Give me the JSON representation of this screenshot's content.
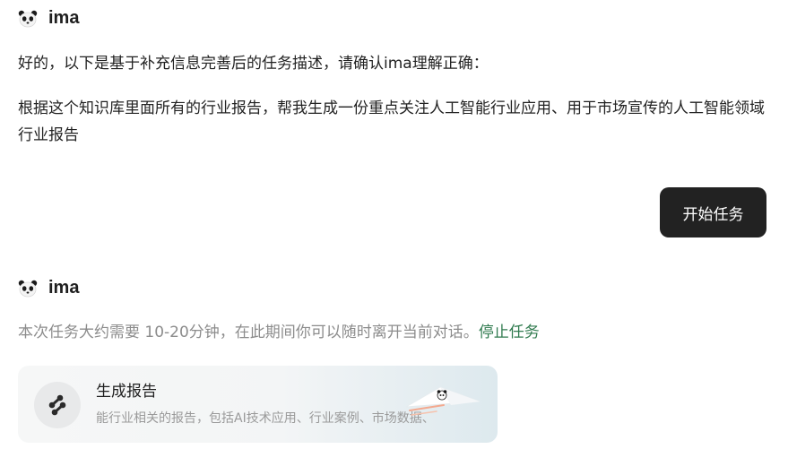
{
  "messages": [
    {
      "sender": "ima",
      "avatar_icon": "panda-icon",
      "intro": "好的，以下是基于补充信息完善后的任务描述，请确认ima理解正确：",
      "task_description": "根据这个知识库里面所有的行业报告，帮我生成一份重点关注人工智能行业应用、用于市场宣传的人工智能领域行业报告",
      "action_button": "开始任务"
    },
    {
      "sender": "ima",
      "avatar_icon": "panda-icon",
      "status_text": "本次任务大约需要 10-20分钟，在此期间你可以随时离开当前对话。",
      "stop_link": "停止任务",
      "card": {
        "icon": "report-generate-icon",
        "title": "生成报告",
        "description": "能行业相关的报告，包括AI技术应用、行业案例、市场数据、"
      }
    }
  ],
  "colors": {
    "button_bg": "#222222",
    "stop_link": "#2f7a4e",
    "muted_text": "#8c8c8c"
  }
}
